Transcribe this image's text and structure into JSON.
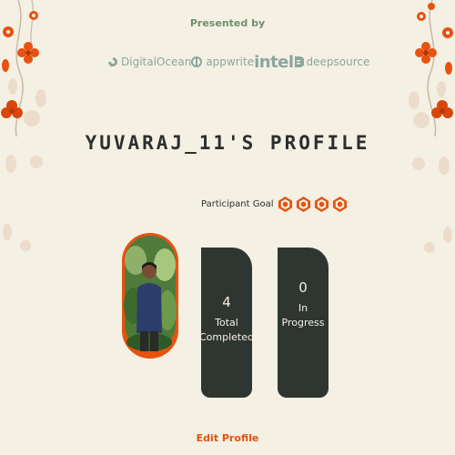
{
  "header": {
    "presented_by": "Presented by"
  },
  "sponsors": [
    {
      "name": "DigitalOcean",
      "icon": "digitalocean-logo-icon"
    },
    {
      "name": "appwrite",
      "icon": "appwrite-logo-icon"
    },
    {
      "name": "intel",
      "icon": "intel-logo-icon"
    },
    {
      "name": "deepsource",
      "icon": "deepsource-logo-icon"
    }
  ],
  "profile": {
    "title": "YUVARAJ_11'S PROFILE",
    "goal_label": "Participant Goal",
    "goal_badges": 4,
    "avatar": "user-avatar-photo"
  },
  "stats": {
    "completed": {
      "value": "4",
      "label_line1": "Total",
      "label_line2": "Completed"
    },
    "in_progress": {
      "value": "0",
      "label": "In Progress"
    }
  },
  "actions": {
    "edit_profile": "Edit Profile"
  },
  "colors": {
    "background": "#f5f0e4",
    "accent": "#e8520f",
    "card": "#2f3632",
    "sponsor_text": "#8aa79a",
    "presented_text": "#6f8f6e"
  }
}
